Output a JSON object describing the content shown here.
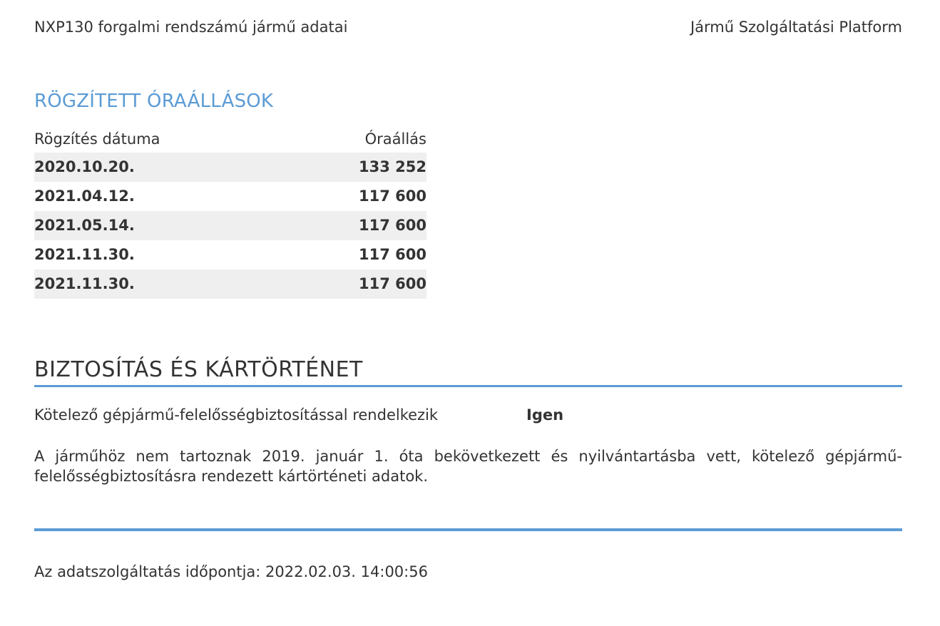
{
  "header": {
    "title": "NXP130 forgalmi rendszámú jármű adatai",
    "platform": "Jármű Szolgáltatási Platform"
  },
  "odometer": {
    "section_title": "RÖGZÍTETT ÓRAÁLLÁSOK",
    "col_date": "Rögzítés dátuma",
    "col_value": "Óraállás",
    "rows": [
      {
        "date": "2020.10.20.",
        "value": "133 252"
      },
      {
        "date": "2021.04.12.",
        "value": "117 600"
      },
      {
        "date": "2021.05.14.",
        "value": "117 600"
      },
      {
        "date": "2021.11.30.",
        "value": "117 600"
      },
      {
        "date": "2021.11.30.",
        "value": "117 600"
      }
    ]
  },
  "insurance": {
    "section_title": "BIZTOSÍTÁS ÉS KÁRTÖRTÉNET",
    "mandatory_label": "Kötelező gépjármű-felelősségbiztosítással rendelkezik",
    "mandatory_value": "Igen",
    "claims_note": "A járműhöz nem tartoznak 2019. január 1. óta bekövetkezett és nyilvántartásba vett, kötelező gépjármű-felelősségbiztosításra rendezett kártörténeti adatok."
  },
  "footer": {
    "timestamp": "Az adatszolgáltatás időpontja: 2022.02.03. 14:00:56"
  },
  "colors": {
    "accent": "#5b9bd5",
    "text": "#333333",
    "row_shade": "#efefef"
  }
}
